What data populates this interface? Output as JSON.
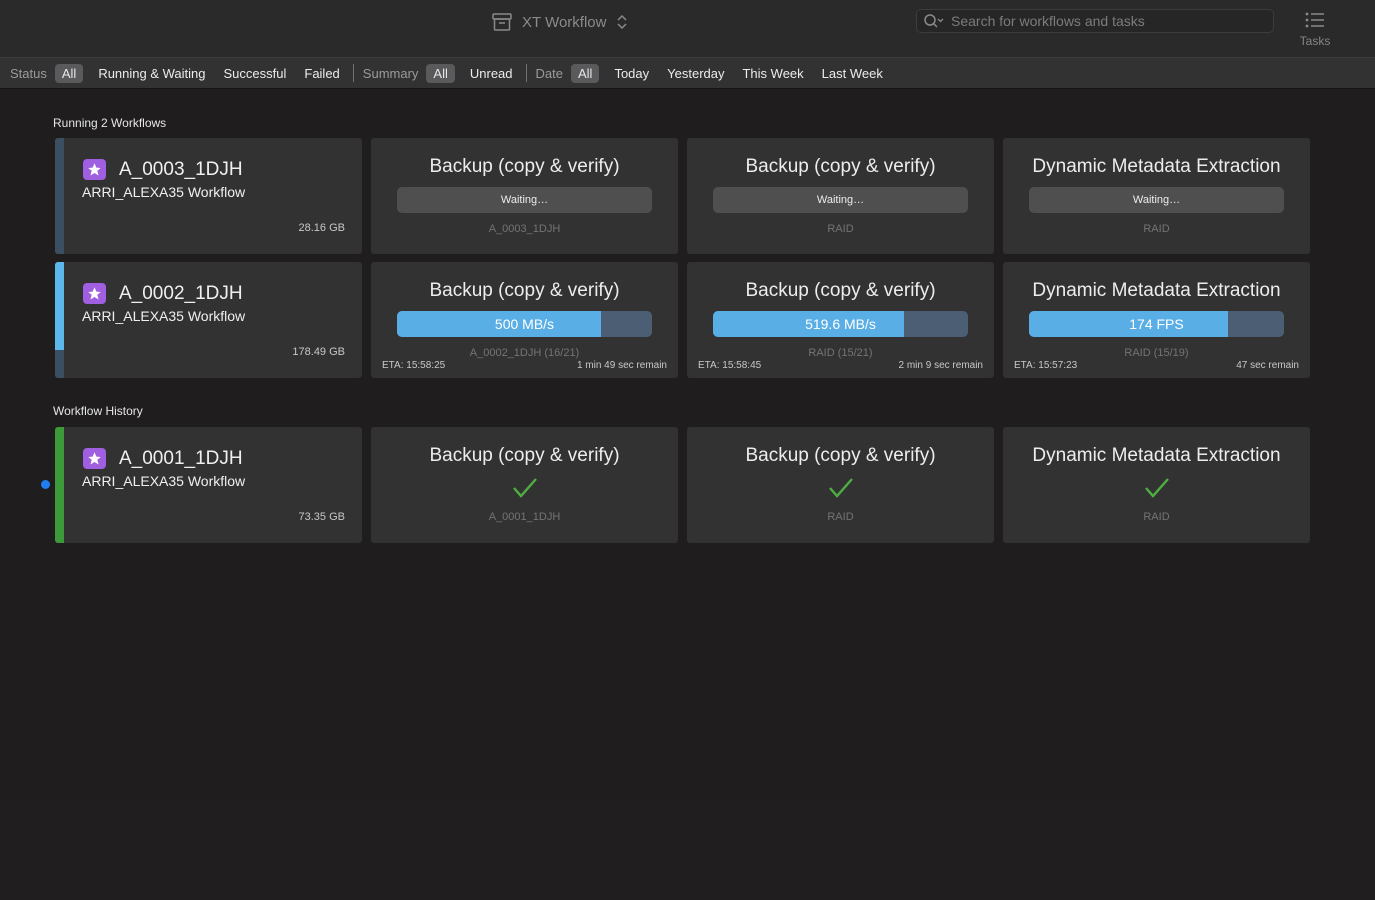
{
  "app": {
    "title": "XT Workflow",
    "search_placeholder": "Search for workflows and tasks",
    "tasks_label": "Tasks"
  },
  "filters": {
    "status": {
      "label": "Status",
      "active": "All",
      "items": [
        "Running & Waiting",
        "Successful",
        "Failed"
      ]
    },
    "summary": {
      "label": "Summary",
      "active": "All",
      "items": [
        "Unread"
      ]
    },
    "date": {
      "label": "Date",
      "active": "All",
      "items": [
        "Today",
        "Yesterday",
        "This Week",
        "Last Week"
      ]
    }
  },
  "running": {
    "title": "Running 2 Workflows",
    "workflows": [
      {
        "name": "A_0003_1DJH",
        "subtitle": "ARRI_ALEXA35 Workflow",
        "size": "28.16 GB",
        "progress": 0,
        "tasks": [
          {
            "title": "Backup (copy & verify)",
            "state": "waiting",
            "label": "Waiting…",
            "target": "A_0003_1DJH"
          },
          {
            "title": "Backup (copy & verify)",
            "state": "waiting",
            "label": "Waiting…",
            "target": "RAID"
          },
          {
            "title": "Dynamic Metadata Extraction",
            "state": "waiting",
            "label": "Waiting…",
            "target": "RAID"
          }
        ]
      },
      {
        "name": "A_0002_1DJH",
        "subtitle": "ARRI_ALEXA35 Workflow",
        "size": "178.49 GB",
        "progress": 0.76,
        "tasks": [
          {
            "title": "Backup (copy & verify)",
            "state": "running",
            "label": "500 MB/s",
            "progress": 0.8,
            "target": "A_0002_1DJH (16/21)",
            "eta": "ETA: 15:58:25",
            "remain": "1 min 49 sec remain"
          },
          {
            "title": "Backup (copy & verify)",
            "state": "running",
            "label": "519.6 MB/s",
            "progress": 0.75,
            "target": "RAID (15/21)",
            "eta": "ETA: 15:58:45",
            "remain": "2 min 9 sec remain"
          },
          {
            "title": "Dynamic Metadata Extraction",
            "state": "running",
            "label": "174 FPS",
            "progress": 0.78,
            "target": "RAID (15/19)",
            "eta": "ETA: 15:57:23",
            "remain": "47 sec remain"
          }
        ]
      }
    ]
  },
  "history": {
    "title": "Workflow History",
    "workflows": [
      {
        "name": "A_0001_1DJH",
        "subtitle": "ARRI_ALEXA35 Workflow",
        "size": "73.35 GB",
        "unread": true,
        "tasks": [
          {
            "title": "Backup (copy & verify)",
            "state": "done",
            "target": "A_0001_1DJH"
          },
          {
            "title": "Backup (copy & verify)",
            "state": "done",
            "target": "RAID"
          },
          {
            "title": "Dynamic Metadata Extraction",
            "state": "done",
            "target": "RAID"
          }
        ]
      }
    ]
  },
  "colors": {
    "accent_progress": "#5aaee6",
    "progress_track": "#4b5e73",
    "success": "#3d9a3a",
    "check": "#4caf3f",
    "star": "#a05ee0",
    "unread_dot": "#1f7ff0"
  },
  "icons": {
    "title": "archive-box-icon",
    "title_switch": "chevron-up-down-icon",
    "search": "search-icon",
    "tasks": "list-icon",
    "workflow": "star-icon",
    "done": "checkmark-icon"
  }
}
